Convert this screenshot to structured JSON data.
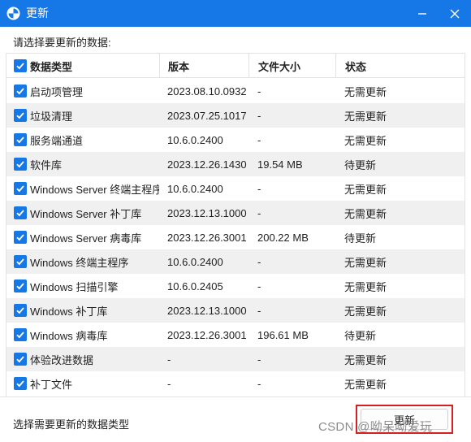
{
  "window": {
    "title": "更新"
  },
  "prompt": "请选择要更新的数据:",
  "table": {
    "headers": {
      "name": "数据类型",
      "version": "版本",
      "size": "文件大小",
      "status": "状态"
    },
    "rows": [
      {
        "name": "启动项管理",
        "version": "2023.08.10.0932",
        "size": "-",
        "status": "无需更新",
        "checked": true
      },
      {
        "name": "垃圾清理",
        "version": "2023.07.25.1017",
        "size": "-",
        "status": "无需更新",
        "checked": true
      },
      {
        "name": "服务端通道",
        "version": "10.6.0.2400",
        "size": "-",
        "status": "无需更新",
        "checked": true
      },
      {
        "name": "软件库",
        "version": "2023.12.26.1430",
        "size": "19.54 MB",
        "status": "待更新",
        "checked": true
      },
      {
        "name": "Windows Server 终端主程序",
        "version": "10.6.0.2400",
        "size": "-",
        "status": "无需更新",
        "checked": true
      },
      {
        "name": "Windows Server 补丁库",
        "version": "2023.12.13.1000",
        "size": "-",
        "status": "无需更新",
        "checked": true
      },
      {
        "name": "Windows Server 病毒库",
        "version": "2023.12.26.3001",
        "size": "200.22 MB",
        "status": "待更新",
        "checked": true
      },
      {
        "name": "Windows 终端主程序",
        "version": "10.6.0.2400",
        "size": "-",
        "status": "无需更新",
        "checked": true
      },
      {
        "name": "Windows 扫描引擎",
        "version": "10.6.0.2405",
        "size": "-",
        "status": "无需更新",
        "checked": true
      },
      {
        "name": "Windows 补丁库",
        "version": "2023.12.13.1000",
        "size": "-",
        "status": "无需更新",
        "checked": true
      },
      {
        "name": "Windows 病毒库",
        "version": "2023.12.26.3001",
        "size": "196.61 MB",
        "status": "待更新",
        "checked": true
      },
      {
        "name": "体验改进数据",
        "version": "-",
        "size": "-",
        "status": "无需更新",
        "checked": true
      },
      {
        "name": "补丁文件",
        "version": "-",
        "size": "-",
        "status": "无需更新",
        "checked": true
      }
    ]
  },
  "footer": {
    "hint": "选择需要更新的数据类型",
    "update_label": "更新"
  },
  "watermark": "CSDN @呦呆呦爱玩",
  "colors": {
    "accent": "#1677e6",
    "highlight": "#d42020"
  },
  "icons": {
    "app": "shield-logo-icon",
    "minimize": "minimize-icon",
    "close": "close-icon",
    "checkbox": "checkmark-icon"
  }
}
